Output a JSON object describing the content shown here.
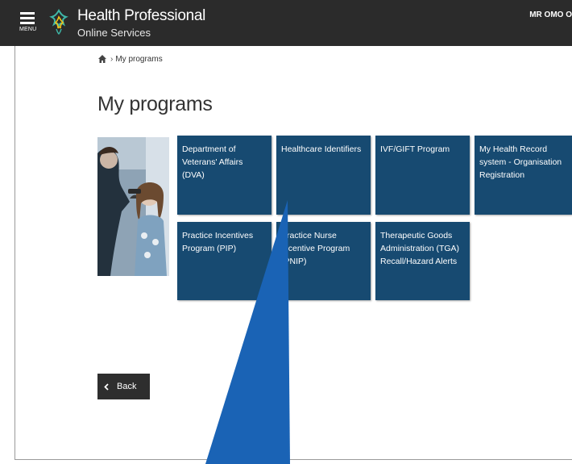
{
  "header": {
    "menu_label": "MENU",
    "brand_title": "Health Professional",
    "brand_subtitle": "Online Services",
    "user_name": "MR OMO O"
  },
  "breadcrumb": {
    "separator": "›",
    "current": "My programs"
  },
  "page_title": "My programs",
  "programs": [
    {
      "label": "Department of Veterans' Affairs (DVA)"
    },
    {
      "label": "Healthcare Identifiers"
    },
    {
      "label": "IVF/GIFT Program"
    },
    {
      "label": "My Health Record system - Organisation Registration"
    },
    {
      "label": "Practice Incentives Program (PIP)"
    },
    {
      "label": "Practice Nurse Incentive Program (PNIP)"
    },
    {
      "label": "Therapeutic Goods Administration (TGA) Recall/Hazard Alerts"
    }
  ],
  "back_button": {
    "label": "Back"
  },
  "colors": {
    "header_bg": "#2b2b2b",
    "tile_bg": "#174a71",
    "annotation_arrow": "#1a63b5",
    "back_bg": "#2e2e2e"
  }
}
